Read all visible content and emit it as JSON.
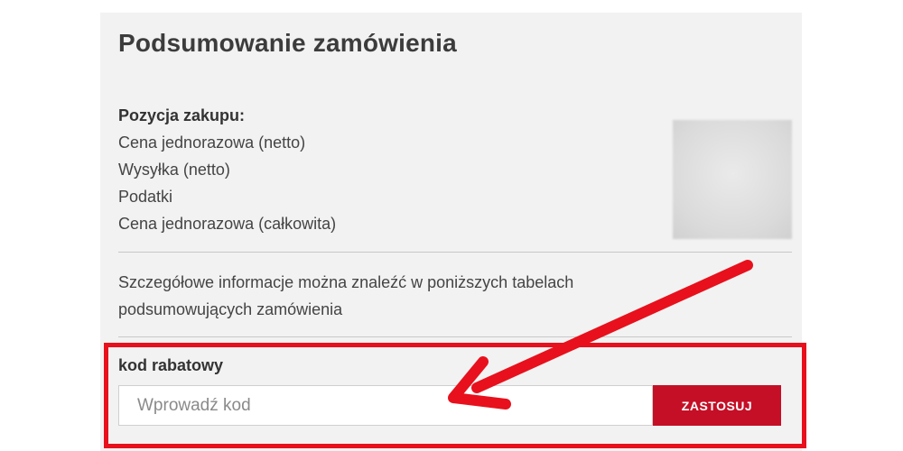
{
  "summary": {
    "title": "Podsumowanie zamówienia",
    "section_heading": "Pozycja zakupu:",
    "lines": [
      "Cena jednorazowa (netto)",
      "Wysyłka (netto)",
      "Podatki",
      "Cena jednorazowa (całkowita)"
    ],
    "info_text": "Szczegółowe informacje można znaleźć w poniższych tabelach podsumowujących zamówienia"
  },
  "coupon": {
    "label": "kod rabatowy",
    "placeholder": "Wprowadź kod",
    "value": "",
    "apply_label": "ZASTOSUJ"
  },
  "annotation": {
    "color": "#e8101c"
  },
  "colors": {
    "button_background": "#c50f26",
    "panel_background": "#f2f2f2"
  }
}
